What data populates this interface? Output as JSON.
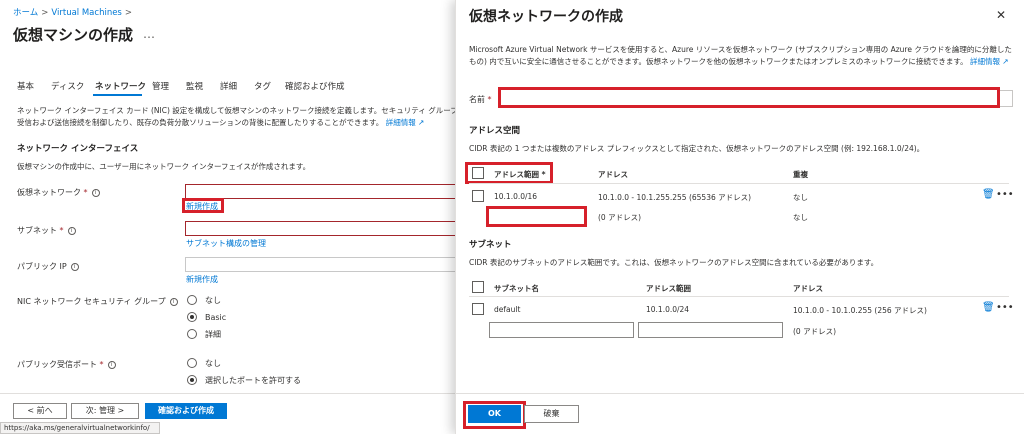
{
  "left": {
    "breadcrumb": {
      "home": "ホーム",
      "vm": "Virtual Machines",
      "sep": ">"
    },
    "page_title": "仮想マシンの作成",
    "more": "…",
    "tabs": [
      "基本",
      "ディスク",
      "ネットワーク",
      "管理",
      "監視",
      "詳細",
      "タグ",
      "確認および作成"
    ],
    "description_line1": "ネットワーク インターフェイス カード (NIC) 設定を構成して仮想マシンのネットワーク接続を定義します。セキュリティ グループの規則",
    "description_line2": "受信および送信接続を制御したり、既存の負荷分散ソリューションの背後に配置したりすることができます。",
    "description_link": "詳細情報",
    "section_title": "ネットワーク インターフェイス",
    "section_sub": "仮想マシンの作成中に、ユーザー用にネットワーク インターフェイスが作成されます。",
    "vnet_label": "仮想ネットワーク",
    "vnet_create": "新規作成",
    "subnet_label": "サブネット",
    "subnet_manage": "サブネット構成の管理",
    "pip_label": "パブリック IP",
    "pip_create": "新規作成",
    "nsg_label": "NIC ネットワーク セキュリティ グループ",
    "nsg_options": [
      "なし",
      "Basic",
      "詳細"
    ],
    "inbound_label": "パブリック受信ポート",
    "inbound_options": [
      "なし",
      "選択したポートを許可する"
    ],
    "prev_button": "< 前へ",
    "next_button": "次: 管理 >",
    "review_button": "確認および作成",
    "status_url": "https://aka.ms/generalvirtualnetworkinfo/"
  },
  "right": {
    "title": "仮想ネットワークの作成",
    "desc_line1": "Microsoft Azure Virtual Network サービスを使用すると、Azure リソースを仮想ネットワーク (サブスクリプション専用の Azure クラウドを論理的に分離した",
    "desc_line2": "もの) 内で互いに安全に通信させることができます。仮想ネットワークを他の仮想ネットワークまたはオンプレミスのネットワークに接続できます。",
    "desc_link": "詳細情報",
    "name_label": "名前",
    "address_space_title": "アドレス空間",
    "address_space_desc": "CIDR 表記の 1 つまたは複数のアドレス プレフィックスとして指定された、仮想ネットワークのアドレス空間 (例: 192.168.1.0/24)。",
    "as_headers": {
      "range": "アドレス範囲",
      "address": "アドレス",
      "overlap": "重複"
    },
    "as_rows": [
      {
        "range": "10.1.0.0/16",
        "address": "10.1.0.0 - 10.1.255.255 (65536 アドレス)",
        "overlap": "なし"
      },
      {
        "range": "",
        "address": "(0 アドレス)",
        "overlap": "なし"
      }
    ],
    "subnet_title": "サブネット",
    "subnet_desc": "CIDR 表記のサブネットのアドレス範囲です。これは、仮想ネットワークのアドレス空間に含まれている必要があります。",
    "sn_headers": {
      "name": "サブネット名",
      "range": "アドレス範囲",
      "address": "アドレス"
    },
    "sn_rows": [
      {
        "name": "default",
        "range": "10.1.0.0/24",
        "address": "10.1.0.0 - 10.1.0.255 (256 アドレス)"
      },
      {
        "name": "",
        "range": "",
        "address": "(0 アドレス)"
      }
    ],
    "ok_button": "OK",
    "discard_button": "破棄"
  },
  "colors": {
    "accent": "#0078d4",
    "highlight": "#d6202a",
    "error": "#a4262c"
  },
  "icons": {
    "close": "close-icon",
    "info": "info-icon",
    "trash": "trash-icon",
    "external": "external-link-icon"
  }
}
